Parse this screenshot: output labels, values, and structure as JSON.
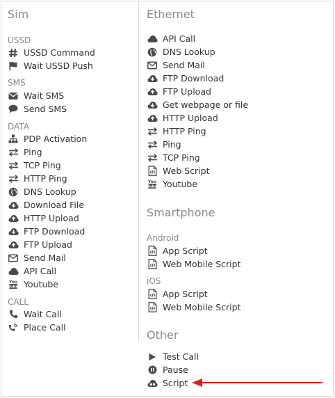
{
  "sim": {
    "title": "Sim",
    "groups": [
      {
        "title": "USSD",
        "items": [
          {
            "label": "USSD Command",
            "icon": "hash-icon"
          },
          {
            "label": "Wait USSD Push",
            "icon": "flag-icon"
          }
        ]
      },
      {
        "title": "SMS",
        "items": [
          {
            "label": "Wait SMS",
            "icon": "envelope-icon"
          },
          {
            "label": "Send SMS",
            "icon": "chat-bubble-icon"
          }
        ]
      },
      {
        "title": "DATA",
        "items": [
          {
            "label": "PDP Activation",
            "icon": "sitemap-icon"
          },
          {
            "label": "Ping",
            "icon": "exchange-icon"
          },
          {
            "label": "TCP Ping",
            "icon": "exchange-icon"
          },
          {
            "label": "HTTP Ping",
            "icon": "exchange-icon"
          },
          {
            "label": "DNS Lookup",
            "icon": "globe-icon"
          },
          {
            "label": "Download File",
            "icon": "cloud-download-icon"
          },
          {
            "label": "HTTP Upload",
            "icon": "cloud-upload-icon"
          },
          {
            "label": "FTP Download",
            "icon": "cloud-download-icon"
          },
          {
            "label": "FTP Upload",
            "icon": "cloud-upload-icon"
          },
          {
            "label": "Send Mail",
            "icon": "envelope-outline-icon"
          },
          {
            "label": "API Call",
            "icon": "cloud-icon"
          },
          {
            "label": "Youtube",
            "icon": "youtube-icon"
          }
        ]
      },
      {
        "title": "CALL",
        "items": [
          {
            "label": "Wait Call",
            "icon": "phone-icon"
          },
          {
            "label": "Place Call",
            "icon": "phone-ring-icon"
          }
        ]
      }
    ]
  },
  "ethernet": {
    "title": "Ethernet",
    "items": [
      {
        "label": "API Call",
        "icon": "cloud-icon"
      },
      {
        "label": "DNS Lookup",
        "icon": "globe-icon"
      },
      {
        "label": "Send Mail",
        "icon": "envelope-outline-icon"
      },
      {
        "label": "FTP Download",
        "icon": "cloud-download-icon"
      },
      {
        "label": "FTP Upload",
        "icon": "cloud-upload-icon"
      },
      {
        "label": "Get webpage or file",
        "icon": "cloud-download-icon"
      },
      {
        "label": "HTTP Upload",
        "icon": "cloud-upload-icon"
      },
      {
        "label": "HTTP Ping",
        "icon": "exchange-icon"
      },
      {
        "label": "Ping",
        "icon": "exchange-icon"
      },
      {
        "label": "TCP Ping",
        "icon": "exchange-icon"
      },
      {
        "label": "Web Script",
        "icon": "code-file-icon"
      },
      {
        "label": "Youtube",
        "icon": "youtube-icon"
      }
    ]
  },
  "smartphone": {
    "title": "Smartphone",
    "groups": [
      {
        "title": "Android",
        "items": [
          {
            "label": "App Script",
            "icon": "code-file-icon"
          },
          {
            "label": "Web Mobile Script",
            "icon": "code-file-icon"
          }
        ]
      },
      {
        "title": "iOS",
        "items": [
          {
            "label": "App Script",
            "icon": "code-file-icon"
          },
          {
            "label": "Web Mobile Script",
            "icon": "code-file-icon"
          }
        ]
      }
    ]
  },
  "other": {
    "title": "Other",
    "items": [
      {
        "label": "Test Call",
        "icon": "play-icon"
      },
      {
        "label": "Pause",
        "icon": "pause-circle-icon"
      },
      {
        "label": "Script",
        "icon": "cloud-script-icon"
      }
    ]
  },
  "colors": {
    "annotation_arrow": "#e01e1e",
    "section_title": "#8a8a8a",
    "icon": "#4a4a4a"
  }
}
